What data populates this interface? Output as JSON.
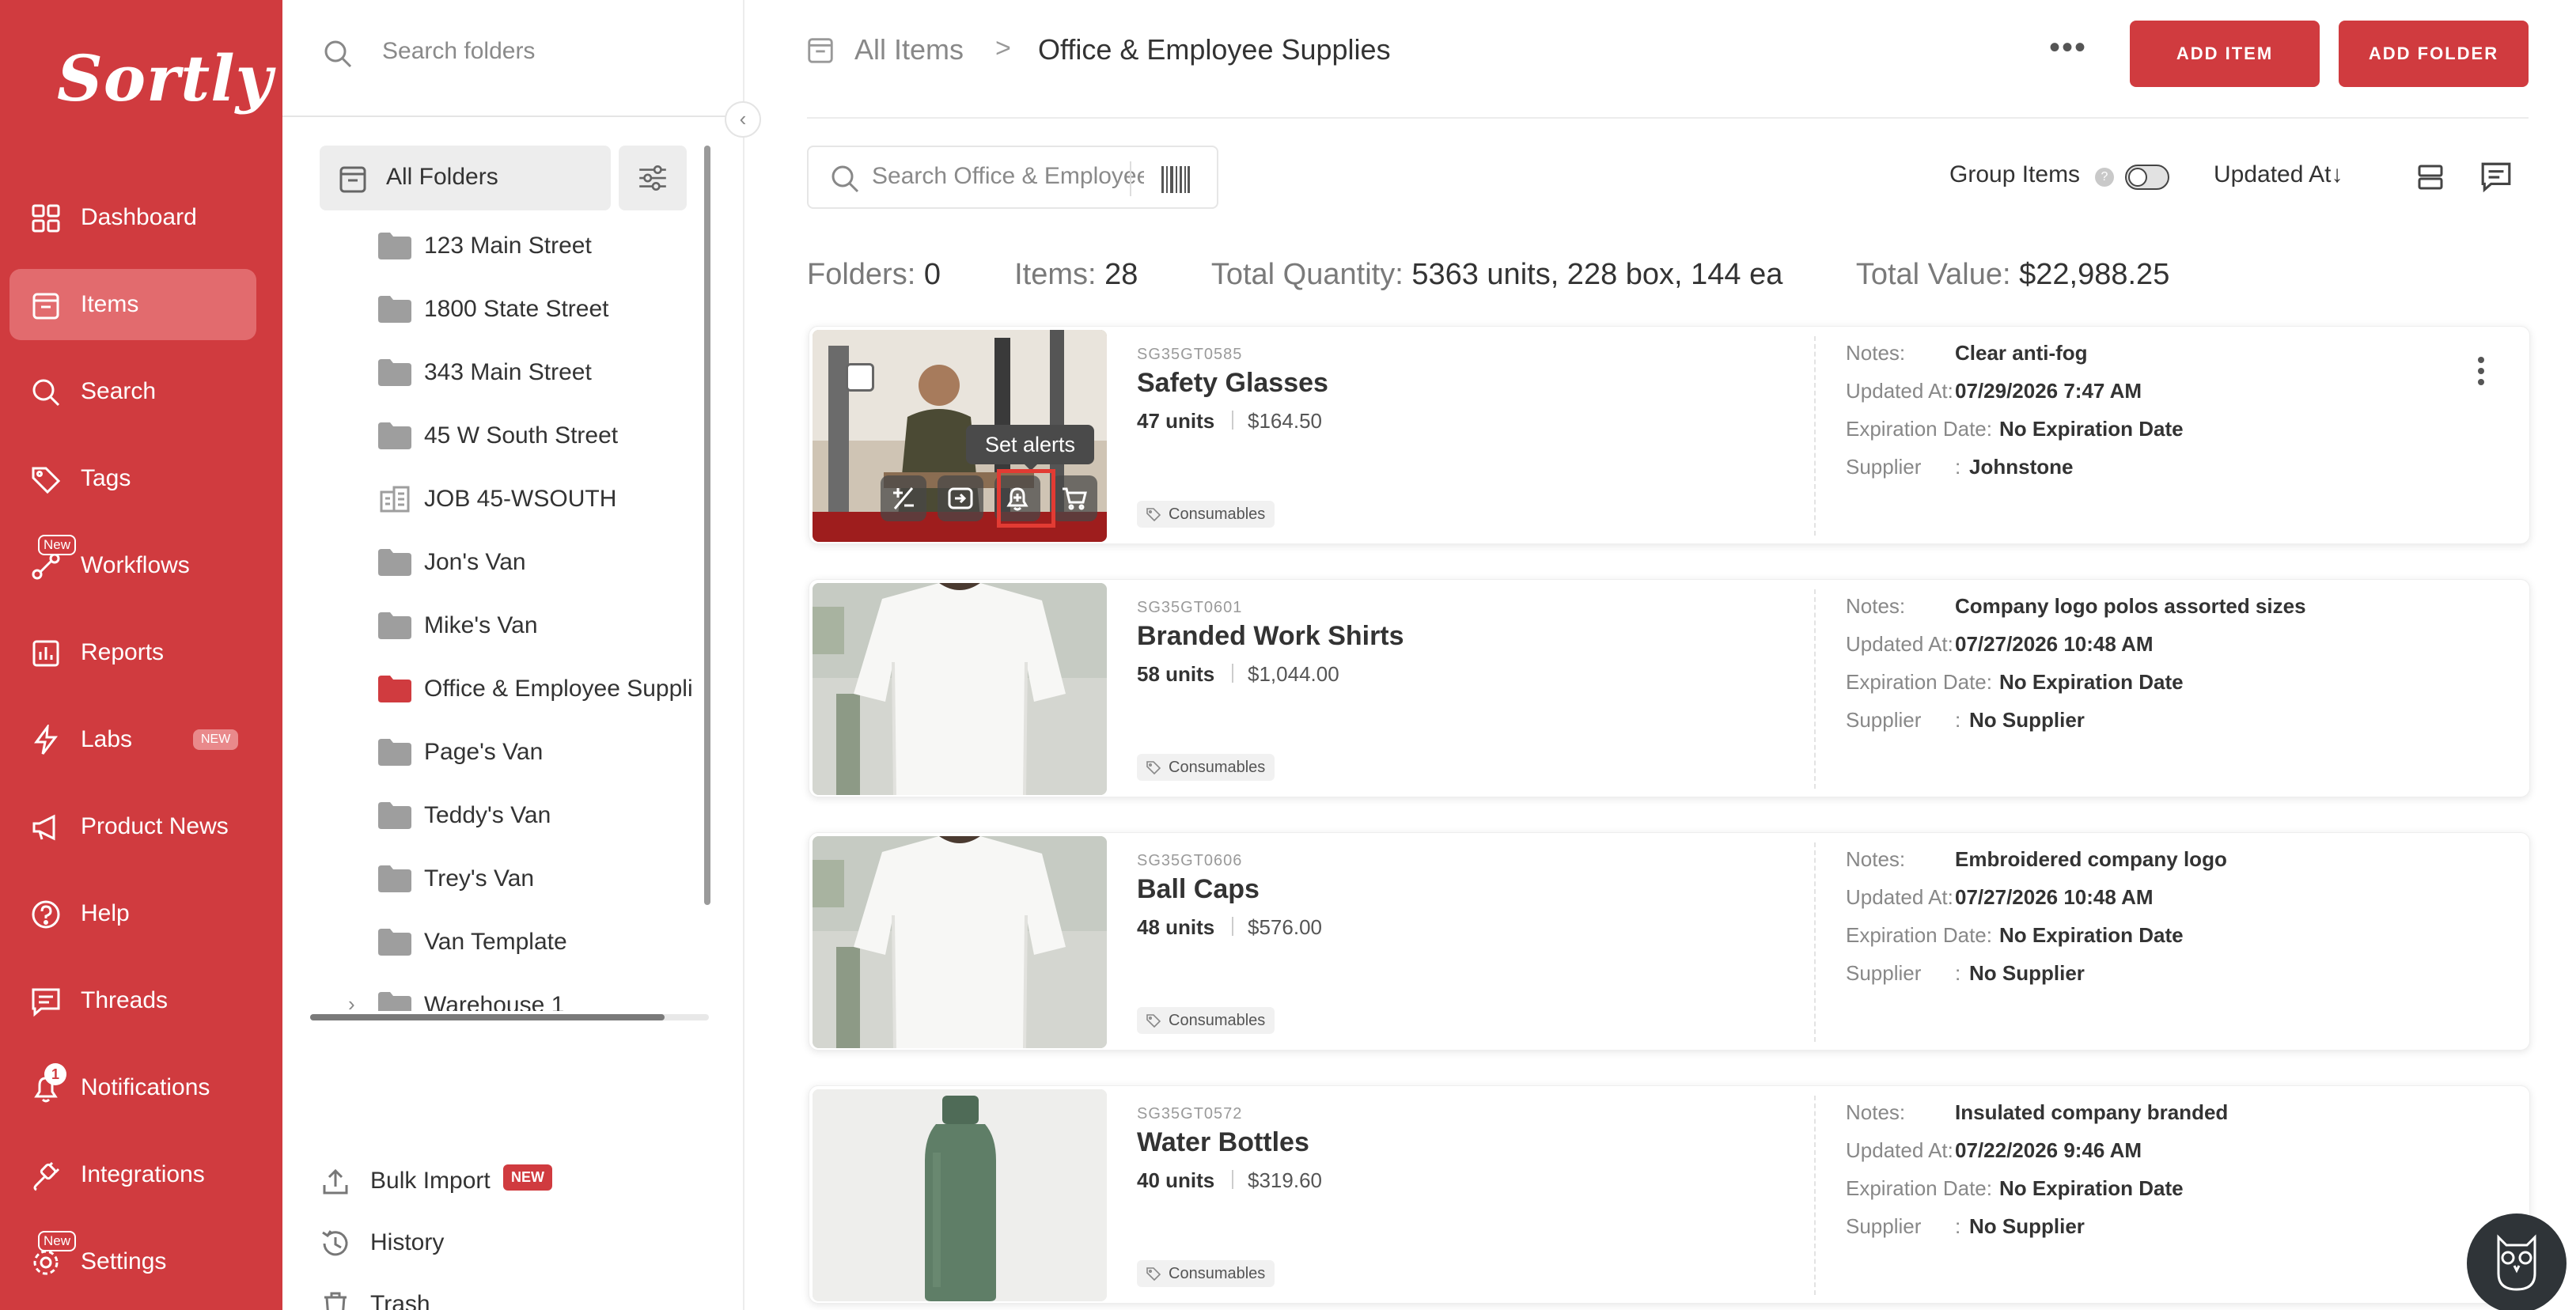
{
  "app": {
    "logo": "Sortly"
  },
  "colors": {
    "brand": "#d03b3f",
    "nav_active": "#e26b6e",
    "highlight": "#e23b33"
  },
  "nav": {
    "items": [
      {
        "label": "Dashboard",
        "icon": "dashboard-icon"
      },
      {
        "label": "Items",
        "icon": "items-icon",
        "active": true
      },
      {
        "label": "Search",
        "icon": "search-icon"
      },
      {
        "label": "Tags",
        "icon": "tag-icon"
      },
      {
        "label": "Workflows",
        "icon": "workflows-icon",
        "badge_top": "New"
      },
      {
        "label": "Reports",
        "icon": "reports-icon"
      },
      {
        "label": "Labs",
        "icon": "labs-icon",
        "badge_pill": "NEW"
      },
      {
        "label": "Product News",
        "icon": "megaphone-icon"
      },
      {
        "label": "Help",
        "icon": "help-icon"
      },
      {
        "label": "Threads",
        "icon": "threads-icon"
      },
      {
        "label": "Notifications",
        "icon": "bell-icon",
        "count": "1"
      },
      {
        "label": "Integrations",
        "icon": "integrations-icon"
      },
      {
        "label": "Settings",
        "icon": "gear-icon",
        "badge_top": "New"
      }
    ]
  },
  "folders": {
    "search_placeholder": "Search folders",
    "all_label": "All Folders",
    "list": [
      {
        "label": "123 Main Street",
        "type": "folder"
      },
      {
        "label": "1800 State Street",
        "type": "folder"
      },
      {
        "label": "343 Main Street",
        "type": "folder"
      },
      {
        "label": "45 W South Street",
        "type": "folder"
      },
      {
        "label": "JOB 45-WSOUTH",
        "type": "building"
      },
      {
        "label": "Jon's Van",
        "type": "folder"
      },
      {
        "label": "Mike's Van",
        "type": "folder"
      },
      {
        "label": "Office & Employee Suppli",
        "type": "folder",
        "active": true
      },
      {
        "label": "Page's Van",
        "type": "folder"
      },
      {
        "label": "Teddy's Van",
        "type": "folder"
      },
      {
        "label": "Trey's Van",
        "type": "folder"
      },
      {
        "label": "Van Template",
        "type": "folder"
      },
      {
        "label": "Warehouse 1",
        "type": "folder",
        "expandable": true
      }
    ],
    "bottom": [
      {
        "label": "Bulk Import",
        "icon": "upload-icon",
        "badge": "NEW"
      },
      {
        "label": "History",
        "icon": "history-icon"
      },
      {
        "label": "Trash",
        "icon": "trash-icon"
      }
    ]
  },
  "header": {
    "breadcrumb_root": "All Items",
    "breadcrumb_sep": ">",
    "breadcrumb_current": "Office & Employee Supplies",
    "more": "•••",
    "add_item": "ADD ITEM",
    "add_folder": "ADD FOLDER"
  },
  "toolbar": {
    "search_placeholder": "Search Office & Employee Supplies",
    "group_items": "Group Items",
    "help_glyph": "?",
    "sort_label": "Updated At",
    "sort_arrow": "↓"
  },
  "stats": {
    "folders_label": "Folders:",
    "folders_value": "0",
    "items_label": "Items:",
    "items_value": "28",
    "qty_label": "Total Quantity:",
    "qty_value": "5363 units, 228 box, 144 ea",
    "value_label": "Total Value:",
    "value_value": "$22,988.25"
  },
  "field_labels": {
    "notes": "Notes:",
    "updated": "Updated At:",
    "expiration": "Expiration Date:",
    "supplier": "Supplier",
    "supplier_colon": ":"
  },
  "items": [
    {
      "sku": "SG35GT0585",
      "name": "Safety Glasses",
      "qty": "47 units",
      "price": "$164.50",
      "tag": "Consumables",
      "notes": "Clear anti-fog",
      "updated": "07/29/2026 7:47 AM",
      "expiration": "No Expiration Date",
      "supplier": "Johnstone",
      "image": "worker"
    },
    {
      "sku": "SG35GT0601",
      "name": "Branded Work Shirts",
      "qty": "58 units",
      "price": "$1,044.00",
      "tag": "Consumables",
      "notes": "Company logo polos assorted sizes",
      "updated": "07/27/2026 10:48 AM",
      "expiration": "No Expiration Date",
      "supplier": "No Supplier",
      "image": "tshirt"
    },
    {
      "sku": "SG35GT0606",
      "name": "Ball Caps",
      "qty": "48 units",
      "price": "$576.00",
      "tag": "Consumables",
      "notes": "Embroidered company logo",
      "updated": "07/27/2026 10:48 AM",
      "expiration": "No Expiration Date",
      "supplier": "No Supplier",
      "image": "tshirt"
    },
    {
      "sku": "SG35GT0572",
      "name": "Water Bottles",
      "qty": "40 units",
      "price": "$319.60",
      "tag": "Consumables",
      "notes": "Insulated company branded",
      "updated": "07/22/2026 9:46 AM",
      "expiration": "No Expiration Date",
      "supplier": "No Supplier",
      "image": "bottle"
    }
  ],
  "hover": {
    "tooltip": "Set alerts"
  }
}
